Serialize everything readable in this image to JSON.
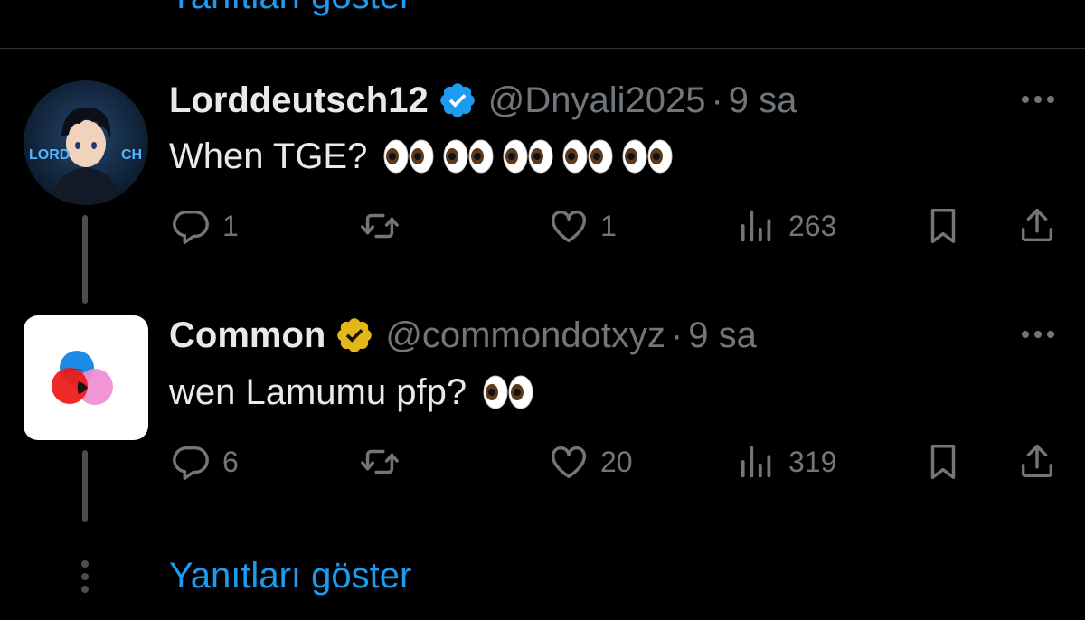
{
  "top_link": {
    "label": "Yanıtları göster"
  },
  "tweets": [
    {
      "name": "Lorddeutsch12",
      "handle": "@Dnyali2025",
      "separator": "·",
      "time": "9 sa",
      "text": "When TGE?",
      "eyes_count": 5,
      "avatar_text_left": "LORD",
      "avatar_text_right": "CH",
      "badge_color": "#1d9bf0",
      "stats": {
        "replies": "1",
        "retweets": "",
        "likes": "1",
        "views": "263"
      }
    },
    {
      "name": "Common",
      "handle": "@commondotxyz",
      "separator": "·",
      "time": "9 sa",
      "text": "wen Lamumu pfp?",
      "eyes_count": 1,
      "badge_color": "#e2b719",
      "stats": {
        "replies": "6",
        "retweets": "",
        "likes": "20",
        "views": "319"
      }
    }
  ],
  "bottom_link": {
    "label": "Yanıtları göster"
  },
  "colors": {
    "background": "#000000",
    "link": "#1d9bf0",
    "muted": "#71767b",
    "text": "#e7e9ea"
  }
}
